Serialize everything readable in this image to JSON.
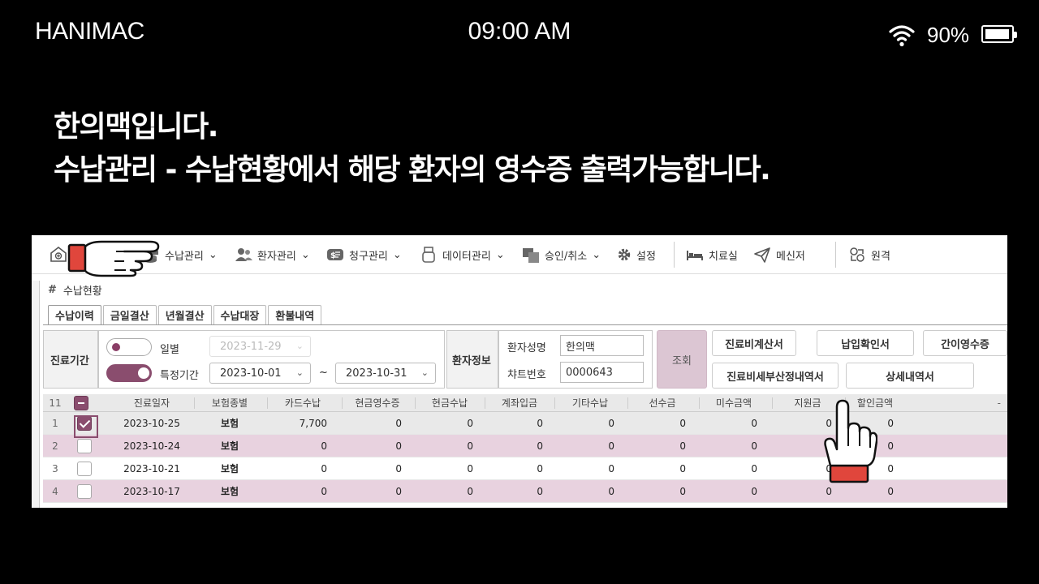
{
  "status_bar": {
    "app_name": "HANIMAC",
    "time": "09:00 AM",
    "battery": "90%",
    "battery_level": 0.9,
    "wifi_icon": "wifi-icon",
    "battery_icon": "battery-icon"
  },
  "caption": {
    "line1": "한의맥입니다.",
    "line2": "수납관리 - 수납현황에서 해당 환자의 영수증 출력가능합니다."
  },
  "toolbar": {
    "items": [
      {
        "label": "수납관리",
        "icon": "coins-icon"
      },
      {
        "label": "환자관리",
        "icon": "users-icon"
      },
      {
        "label": "청구관리",
        "icon": "billing-icon"
      },
      {
        "label": "데이터관리",
        "icon": "usb-icon"
      },
      {
        "label": "승인/취소",
        "icon": "approve-icon"
      },
      {
        "label": "설정",
        "icon": "gear-icon"
      },
      {
        "label": "치료실",
        "icon": "bed-icon"
      },
      {
        "label": "메신저",
        "icon": "send-icon"
      },
      {
        "label": "원격",
        "icon": "remote-icon"
      }
    ]
  },
  "window": {
    "title": "수납현황",
    "title_icon": "hash-icon",
    "tabs": [
      "수납이력",
      "금일결산",
      "년월결산",
      "수납대장",
      "환불내역"
    ]
  },
  "filter": {
    "period_label": "진료기간",
    "daily_label": "일별",
    "range_label": "특정기간",
    "daily_date": "2023-11-29",
    "from_date": "2023-10-01",
    "range_sep": "~",
    "to_date": "2023-10-31",
    "patient_info_label": "환자정보",
    "name_label": "환자성명",
    "name_value": "한의맥",
    "chart_label": "챠트번호",
    "chart_value": "0000643",
    "search_button": "조회",
    "buttons": [
      "진료비계산서",
      "납입확인서",
      "간이영수증",
      "진료비세부산정내역서",
      "상세내역서"
    ]
  },
  "grid": {
    "count": "11",
    "columns": [
      "진료일자",
      "보험종별",
      "카드수납",
      "현금영수증",
      "현금수납",
      "계좌입금",
      "기타수납",
      "선수금",
      "미수금액",
      "지원금",
      "할인금액"
    ],
    "extra_col": "-",
    "rows": [
      {
        "no": "1",
        "checked": true,
        "date": "2023-10-25",
        "type": "보험",
        "card": "7,700",
        "cash_receipt": "0",
        "cash": "0",
        "account": "0",
        "other": "0",
        "advance": "0",
        "unpaid": "0",
        "support": "0",
        "discount": "0"
      },
      {
        "no": "2",
        "checked": false,
        "date": "2023-10-24",
        "type": "보험",
        "card": "0",
        "cash_receipt": "0",
        "cash": "0",
        "account": "0",
        "other": "0",
        "advance": "0",
        "unpaid": "0",
        "support": "0",
        "discount": "0"
      },
      {
        "no": "3",
        "checked": false,
        "date": "2023-10-21",
        "type": "보험",
        "card": "0",
        "cash_receipt": "0",
        "cash": "0",
        "account": "0",
        "other": "0",
        "advance": "0",
        "unpaid": "0",
        "support": "0",
        "discount": "0"
      },
      {
        "no": "4",
        "checked": false,
        "date": "2023-10-17",
        "type": "보험",
        "card": "0",
        "cash_receipt": "0",
        "cash": "0",
        "account": "0",
        "other": "0",
        "advance": "0",
        "unpaid": "0",
        "support": "0",
        "discount": "0"
      }
    ]
  },
  "pointers": {
    "menu_hand_icon": "pointing-hand-icon",
    "click_hand_icon": "tapping-hand-icon",
    "accent": "#e0463c"
  }
}
